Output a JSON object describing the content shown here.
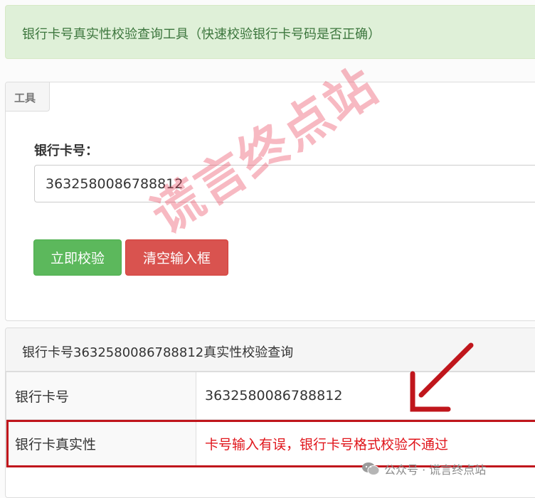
{
  "alert": {
    "text": "银行卡号真实性校验查询工具（快速校验银行卡号码是否正确）"
  },
  "tool": {
    "tab": "工具",
    "label": "银行卡号：",
    "card_value": "3632580086788812",
    "verify_button": "立即校验",
    "clear_button": "清空输入框"
  },
  "watermark": "谎言终点站",
  "result": {
    "heading": "银行卡号3632580086788812真实性校验查询",
    "rows": [
      {
        "key": "银行卡号",
        "value": "3632580086788812"
      },
      {
        "key": "银行卡真实性",
        "value": "卡号输入有误，银行卡号格式校验不通过"
      }
    ]
  },
  "footer": {
    "text": "公众号 · 谎言终点站"
  },
  "colors": {
    "success": "#5cb85c",
    "danger": "#d9534f",
    "highlight": "#c0161c"
  }
}
